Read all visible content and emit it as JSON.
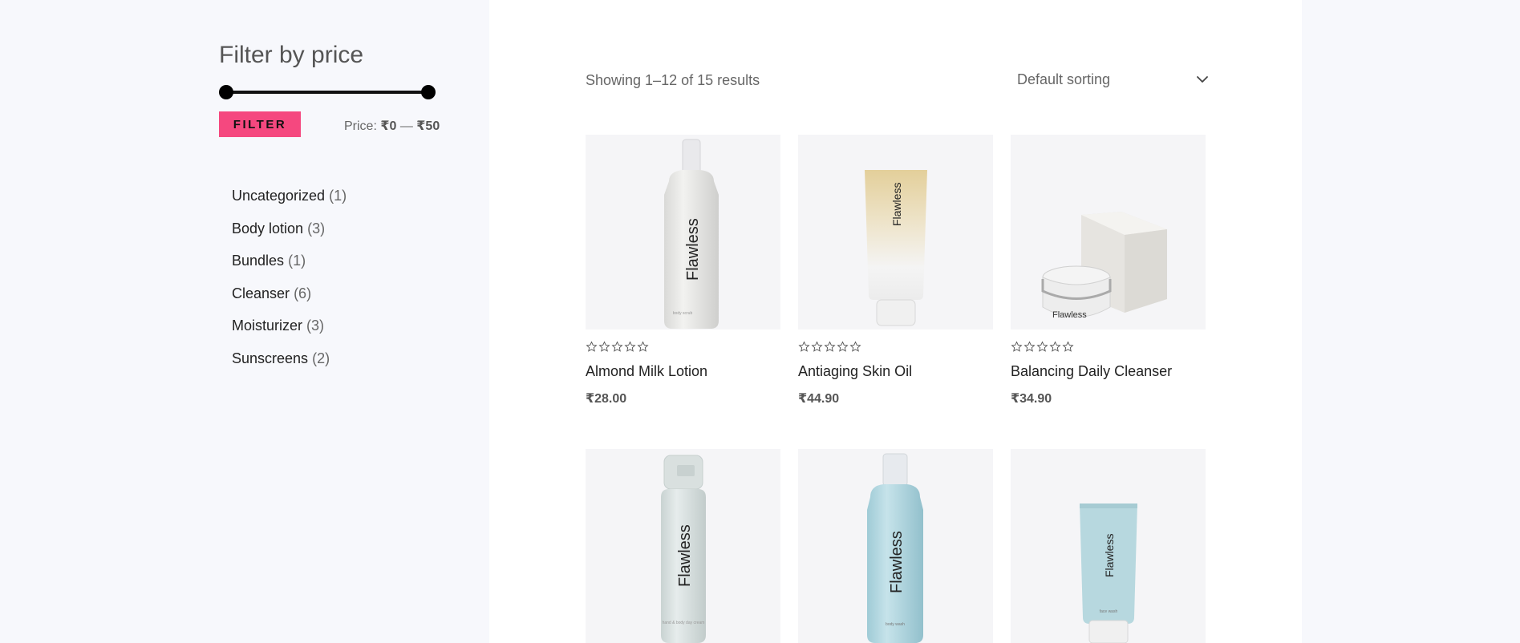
{
  "sidebar": {
    "filter_title": "Filter by price",
    "filter_button": "FILTER",
    "price_prefix": "Price:",
    "price_min": "₹0",
    "price_sep": "—",
    "price_max": "₹50",
    "categories": [
      {
        "name": "Uncategorized",
        "count": "(1)"
      },
      {
        "name": "Body lotion",
        "count": "(3)"
      },
      {
        "name": "Bundles",
        "count": "(1)"
      },
      {
        "name": "Cleanser",
        "count": "(6)"
      },
      {
        "name": "Moisturizer",
        "count": "(3)"
      },
      {
        "name": "Sunscreens",
        "count": "(2)"
      }
    ]
  },
  "main": {
    "result_count": "Showing 1–12 of 15 results",
    "sorting": "Default sorting",
    "products": [
      {
        "name": "Almond Milk Lotion",
        "price": "₹28.00",
        "brand": "Flawless",
        "sub": "body scrub",
        "rating": 0
      },
      {
        "name": "Antiaging Skin Oil",
        "price": "₹44.90",
        "brand": "Flawless",
        "sub": "",
        "rating": 0
      },
      {
        "name": "Balancing Daily Cleanser",
        "price": "₹34.90",
        "brand": "Flawless",
        "sub": "",
        "rating": 0
      },
      {
        "name": "",
        "price": "",
        "brand": "Flawless",
        "sub": "hand & body day cream",
        "rating": 0
      },
      {
        "name": "",
        "price": "",
        "brand": "Flawless",
        "sub": "body wash",
        "rating": 0
      },
      {
        "name": "",
        "price": "",
        "brand": "Flawless",
        "sub": "face wash",
        "rating": 0
      }
    ]
  },
  "colors": {
    "accent": "#f5487f",
    "page_bg": "#f7f8fc",
    "content_bg": "#ffffff",
    "product_bg": "#f5f5f7"
  },
  "icons": {
    "sort": "chevron-down-icon",
    "rating": "star-outline-icon"
  }
}
